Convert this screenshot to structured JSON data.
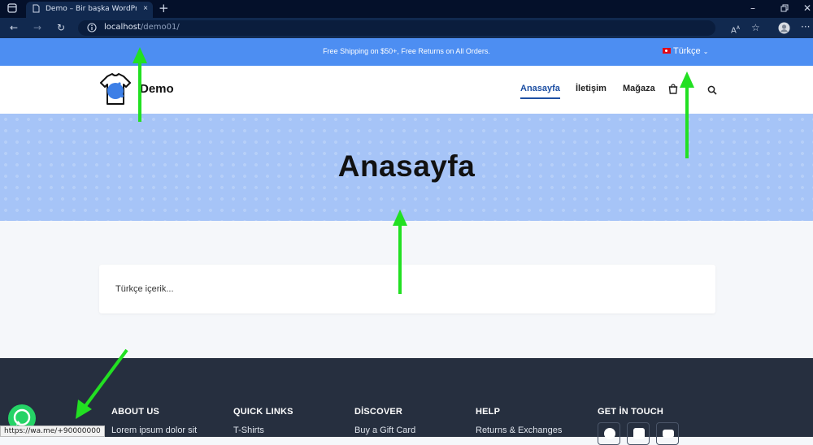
{
  "browser": {
    "tab_title": "Demo – Bir başka WordPress sitesi",
    "tab_close": "×",
    "new_tab": "+",
    "url_host": "localhost",
    "url_path": "/demo01/"
  },
  "topbar": {
    "message": "Free Shipping on $50+, Free Returns on All Orders.",
    "language": "Türkçe"
  },
  "header": {
    "site_name": "Demo",
    "nav": [
      "Anasayfa",
      "İletişim",
      "Mağaza"
    ]
  },
  "hero": {
    "title": "Anasayfa"
  },
  "content": {
    "text": "Türkçe içerik..."
  },
  "footer": {
    "columns": [
      {
        "heading": "ABOUT US",
        "item": "Lorem ipsum dolor sit"
      },
      {
        "heading": "QUICK LINKS",
        "item": "T-Shirts"
      },
      {
        "heading": "DİSCOVER",
        "item": "Buy a Gift Card"
      },
      {
        "heading": "HELP",
        "item": "Returns & Exchanges"
      },
      {
        "heading": "GET İN TOUCH",
        "item": ""
      }
    ],
    "social_icons": [
      "facebook-icon",
      "instagram-icon",
      "youtube-icon"
    ]
  },
  "status_url": "https://wa.me/+90000000",
  "colors": {
    "topbar": "#4d8ef2",
    "hero": "#a6c4f7",
    "nav_active": "#1d4fa3",
    "footer": "#262f3f",
    "annotation_arrow": "#22e022",
    "whatsapp": "#25d366"
  }
}
